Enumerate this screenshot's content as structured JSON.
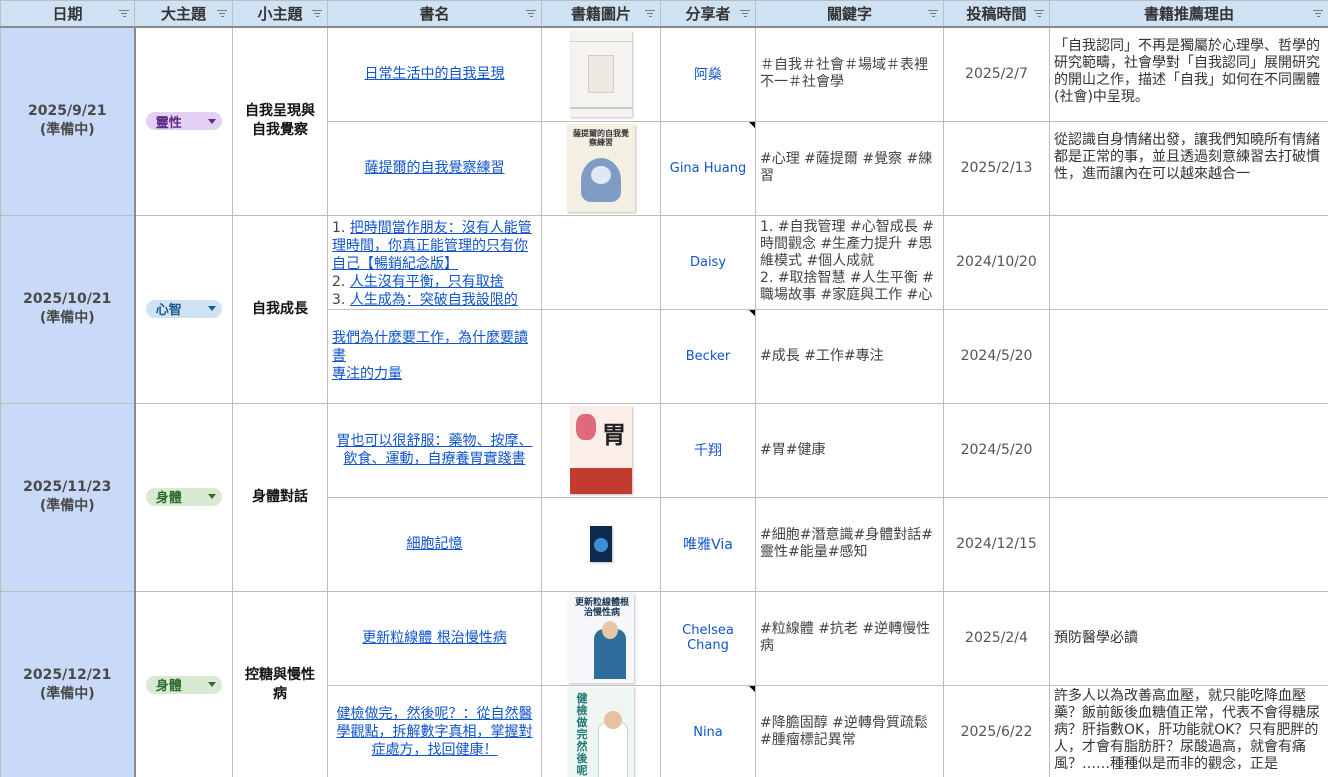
{
  "headers": [
    "日期",
    "大主題",
    "小主題",
    "書名",
    "書籍圖片",
    "分享者",
    "關鍵字",
    "投稿時間",
    "書籍推薦理由"
  ],
  "groups": [
    {
      "date": "2025/9/21",
      "status": "(準備中)",
      "topic": "靈性",
      "topic_color": "#e3d0f3",
      "subtopic": "自我呈現與自我覺察",
      "rows": [
        {
          "title": "日常生活中的自我呈現",
          "sharer": "阿燊",
          "keywords": "＃自我＃社會＃場域＃表裡不一＃社會學",
          "time": "2025/2/7",
          "reason": "「自我認同」不再是獨屬於心理學、哲學的研究範疇，社會學對「自我認同」展開研究的開山之作，描述「自我」如何在不同團體(社會)中呈現。"
        },
        {
          "title": "薩提爾的自我覺察練習",
          "sharer": "Gina Huang",
          "keywords": "#心理 #薩提爾 #覺察 #練習",
          "time": "2025/2/13",
          "reason": "從認識自身情緒出發，讓我們知曉所有情緒都是正常的事，並且透過刻意練習去打破慣性，進而讓內在可以越來越合一",
          "cover_title": "薩提爾的自我覺察練習"
        }
      ]
    },
    {
      "date": "2025/10/21",
      "status": "(準備中)",
      "topic": "心智",
      "topic_color": "#cfe2f3",
      "subtopic": "自我成長",
      "rows": [
        {
          "title_list": [
            {
              "num": "1. ",
              "text": "把時間當作朋友：沒有人能管理時間，你真正能管理的只有你自己【暢銷紀念版】"
            },
            {
              "num": "2. ",
              "text": "人生沒有平衡，只有取捨"
            },
            {
              "num": "3. ",
              "text": "人生成為：突破自我設限的"
            }
          ],
          "sharer": "Daisy",
          "keywords": "1. #自我管理 #心智成長 #時間觀念 #生產力提升 #思維模式 #個人成就\n2. #取捨智慧 #人生平衡 #職場故事 #家庭與工作 #心",
          "time": "2024/10/20",
          "reason": ""
        },
        {
          "title_list": [
            {
              "num": "",
              "text": "我們為什麼要工作，為什麼要讀書"
            },
            {
              "num": "",
              "text": "專注的力量"
            }
          ],
          "sharer": "Becker",
          "keywords": "#成長 #工作#專注",
          "time": "2024/5/20",
          "reason": ""
        }
      ]
    },
    {
      "date": "2025/11/23",
      "status": "(準備中)",
      "topic": "身體",
      "topic_color": "#d9ead3",
      "subtopic": "身體對話",
      "rows": [
        {
          "title": "胃也可以很舒服：藥物、按摩、飲食、運動，自療養胃實踐書",
          "sharer": "千翔",
          "keywords": "#胃#健康",
          "time": "2024/5/20",
          "reason": "",
          "cover_title": "胃"
        },
        {
          "title": "細胞記憶",
          "sharer": "唯雅Via",
          "keywords": "#細胞#潛意識#身體對話#靈性#能量#感知",
          "time": "2024/12/15",
          "reason": ""
        }
      ]
    },
    {
      "date": "2025/12/21",
      "status": "(準備中)",
      "topic": "身體",
      "topic_color": "#d9ead3",
      "subtopic": "控糖與慢性病",
      "rows": [
        {
          "title": "更新粒線體 根治慢性病",
          "sharer": "Chelsea Chang",
          "keywords": "#粒線體 #抗老 #逆轉慢性病",
          "time": "2025/2/4",
          "reason": "預防醫學必讀",
          "cover_title": "更新粒線體根治慢性病"
        },
        {
          "title": "健檢做完，然後呢？：從自然醫學觀點，拆解數字真相，掌握對症處方，找回健康！",
          "sharer": "Nina",
          "keywords": "#降膽固醇 #逆轉骨質疏鬆 #腫瘤標記異常",
          "time": "2025/6/22",
          "reason": "許多人以為改善高血壓，就只能吃降血壓藥？飯前飯後血糖值正常，代表不會得糖尿病？肝指數OK，肝功能就OK？只有肥胖的人，才會有脂肪肝？尿酸過高，就會有痛風？……種種似是而非的觀念，正是",
          "cover_title": "健檢做完然後呢"
        }
      ]
    }
  ]
}
